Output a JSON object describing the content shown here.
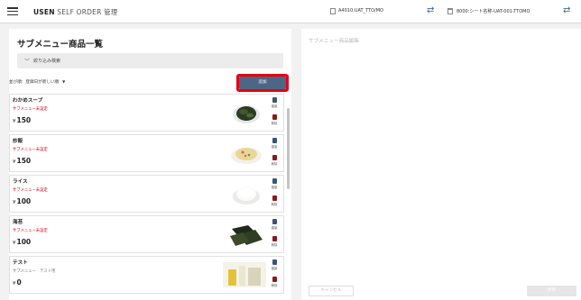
{
  "header": {
    "brand_bold": "USEN",
    "brand_rest": " SELF ORDER 管理",
    "store": "A4010:UAT_TTO/MO",
    "seat": "8000:シート名称-UAT-001-TTOMO"
  },
  "list": {
    "title": "サブメニュー商品一覧",
    "filter_label": "絞り込み検索",
    "sort_label": "並び順：登録日が新しい順",
    "add_label": "追加",
    "copy_label": "複製",
    "delete_label": "削除",
    "currency": "¥",
    "items": [
      {
        "name": "わかめスープ",
        "tag": "サブメニュー未設定",
        "tag_color": "#d0021b",
        "price": "150",
        "thumb": "wakame-soup"
      },
      {
        "name": "炒飯",
        "tag": "サブメニュー未設定",
        "tag_color": "#d0021b",
        "price": "150",
        "thumb": "fried-rice"
      },
      {
        "name": "ライス",
        "tag": "サブメニュー未設定",
        "tag_color": "#d0021b",
        "price": "100",
        "thumb": "rice"
      },
      {
        "name": "海苔",
        "tag": "サブメニュー未設定",
        "tag_color": "#d0021b",
        "price": "100",
        "thumb": "nori"
      },
      {
        "name": "テスト",
        "tag": "サブメニュー　テスト用",
        "tag_color": "#777777",
        "price": "0",
        "thumb": "test-drink"
      }
    ]
  },
  "detail": {
    "title": "サブメニュー商品編集",
    "cancel_label": "キャンセル",
    "update_label": "更新"
  },
  "colors": {
    "accent": "#4c6785",
    "highlight": "#e60012"
  }
}
